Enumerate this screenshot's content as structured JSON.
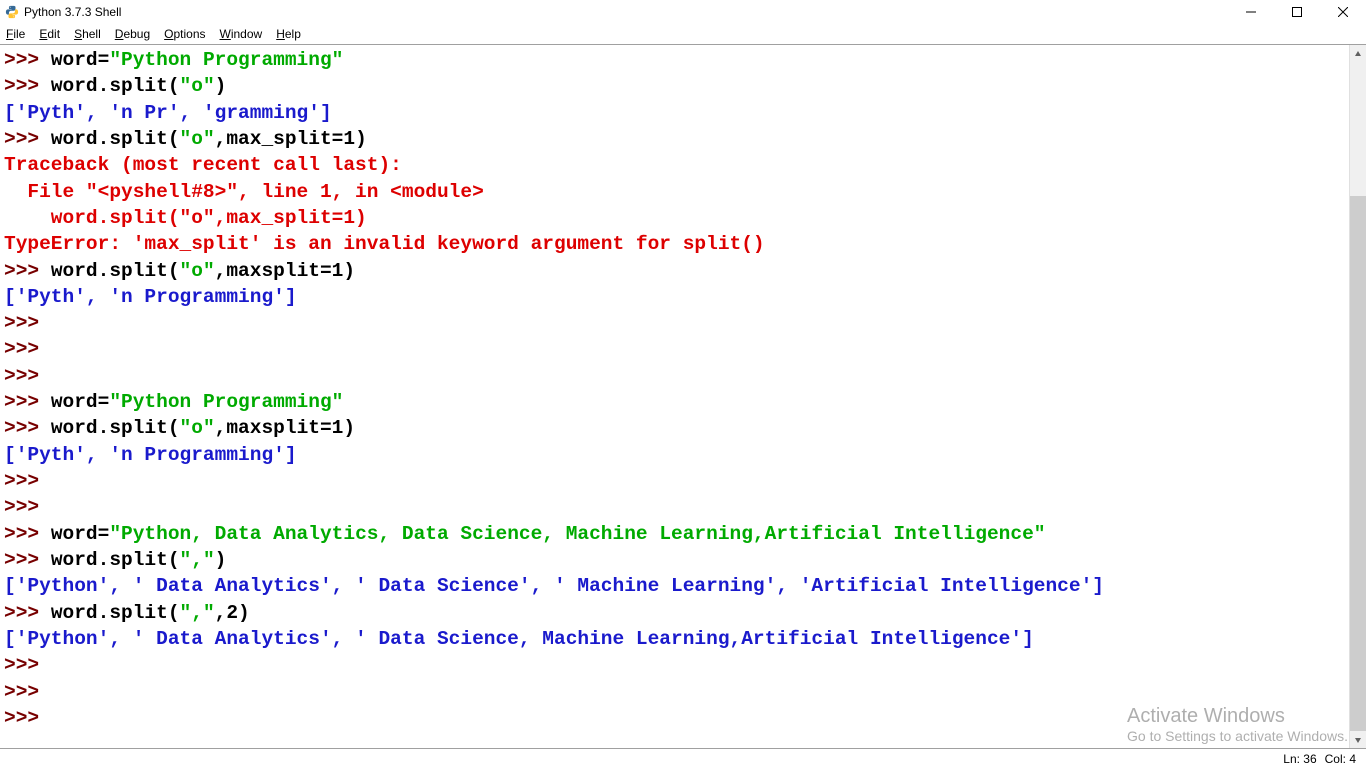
{
  "title": "Python 3.7.3 Shell",
  "menu": {
    "file": {
      "u": "F",
      "rest": "ile"
    },
    "edit": {
      "u": "E",
      "rest": "dit"
    },
    "shell": {
      "u": "S",
      "rest": "hell"
    },
    "debug": {
      "u": "D",
      "rest": "ebug"
    },
    "options": {
      "u": "O",
      "rest": "ptions"
    },
    "window": {
      "u": "W",
      "rest": "indow"
    },
    "help": {
      "u": "H",
      "rest": "elp"
    }
  },
  "code": {
    "p": ">>> ",
    "l1a": "word=",
    "l1b": "\"Python Programming\"",
    "l2": "word.split(",
    "l2b": "\"o\"",
    "l2c": ")",
    "o1": "['Pyth', 'n Pr', 'gramming']",
    "l3": "word.split(",
    "l3b": "\"o\"",
    "l3c": ",max_split=1)",
    "e1": "Traceback (most recent call last):",
    "e2": "  File \"<pyshell#8>\", line 1, in <module>",
    "e3": "    word.split(\"o\",max_split=1)",
    "e4": "TypeError: 'max_split' is an invalid keyword argument for split()",
    "l4": "word.split(",
    "l4b": "\"o\"",
    "l4c": ",maxsplit=1)",
    "o2": "['Pyth', 'n Programming']",
    "l5a": "word=",
    "l5b": "\"Python Programming\"",
    "l6": "word.split(",
    "l6b": "\"o\"",
    "l6c": ",maxsplit=1)",
    "o3": "['Pyth', 'n Programming']",
    "l7a": "word=",
    "l7b": "\"Python, Data Analytics, Data Science, Machine Learning,Artificial Intelligence\"",
    "l8": "word.split(",
    "l8b": "\",\"",
    "l8c": ")",
    "o4": "['Python', ' Data Analytics', ' Data Science', ' Machine Learning', 'Artificial Intelligence']",
    "l9": "word.split(",
    "l9b": "\",\"",
    "l9c": ",2)",
    "o5": "['Python', ' Data Analytics', ' Data Science, Machine Learning,Artificial Intelligence']"
  },
  "status": {
    "ln": "Ln: 36",
    "col": "Col: 4"
  },
  "watermark": {
    "line1": "Activate Windows",
    "line2": "Go to Settings to activate Windows."
  }
}
